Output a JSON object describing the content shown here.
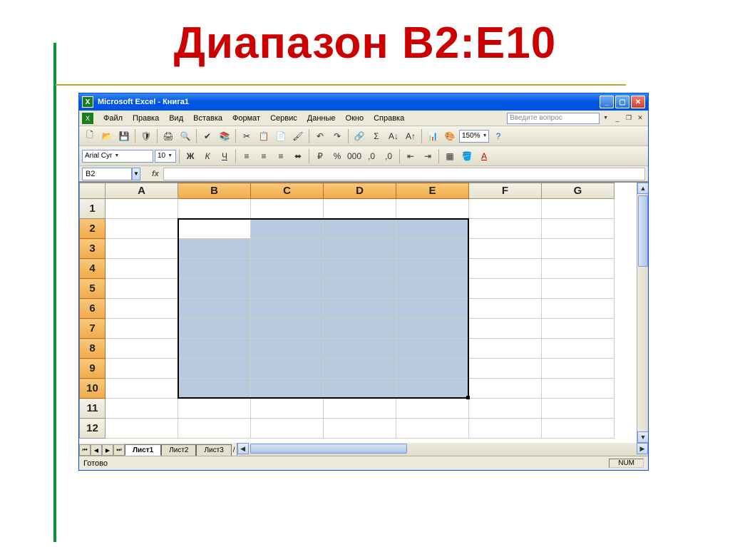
{
  "slide": {
    "title": "Диапазон В2:Е10"
  },
  "window": {
    "title": "Microsoft Excel - Книга1"
  },
  "menu": {
    "items": [
      "Файл",
      "Правка",
      "Вид",
      "Вставка",
      "Формат",
      "Сервис",
      "Данные",
      "Окно",
      "Справка"
    ],
    "help_placeholder": "Введите вопрос"
  },
  "toolbar": {
    "font": "Arial Cyr",
    "size": "10",
    "zoom": "150%"
  },
  "namebox": {
    "cell": "B2",
    "fx": "fx"
  },
  "columns": [
    "A",
    "B",
    "C",
    "D",
    "E",
    "F",
    "G"
  ],
  "rows": [
    "1",
    "2",
    "3",
    "4",
    "5",
    "6",
    "7",
    "8",
    "9",
    "10",
    "11",
    "12"
  ],
  "selected_cols": [
    "B",
    "C",
    "D",
    "E"
  ],
  "selected_rows": [
    "2",
    "3",
    "4",
    "5",
    "6",
    "7",
    "8",
    "9",
    "10"
  ],
  "active_cell": "B2",
  "tabs": {
    "items": [
      "Лист1",
      "Лист2",
      "Лист3"
    ],
    "active": 0,
    "trail": "/"
  },
  "status": {
    "ready": "Готово",
    "num": "NUM"
  }
}
